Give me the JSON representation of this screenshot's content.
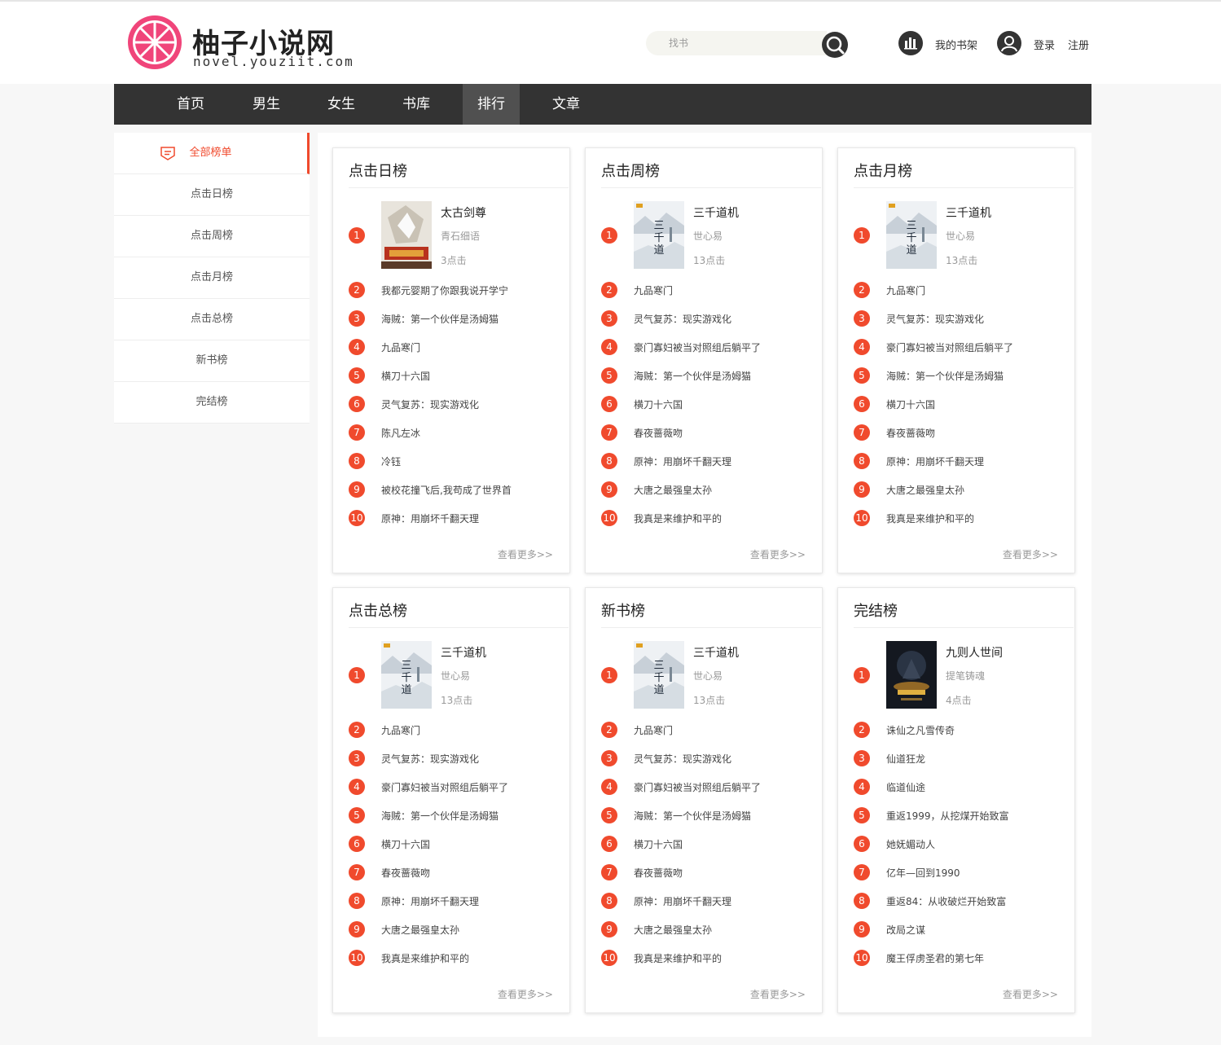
{
  "site": {
    "title": "柚子小说网",
    "subtitle": "novel.youziit.com"
  },
  "search": {
    "placeholder": "找书"
  },
  "header": {
    "shelf": "我的书架",
    "login": "登录",
    "register": "注册"
  },
  "nav": [
    "首页",
    "男生",
    "女生",
    "书库",
    "排行",
    "文章"
  ],
  "sidebar": [
    "全部榜单",
    "点击日榜",
    "点击周榜",
    "点击月榜",
    "点击总榜",
    "新书榜",
    "完结榜"
  ],
  "more_label": "查看更多>>",
  "colors": {
    "accent": "#f04a2d",
    "nav": "#333333"
  },
  "cards": [
    {
      "title": "点击日榜",
      "cover": "dragon",
      "top": {
        "name": "太古剑尊",
        "author": "青石细语",
        "clicks": "3点击"
      },
      "items": [
        "我都元婴期了你跟我说开学宁",
        "海贼：第一个伙伴是汤姆猫",
        "九品寒门",
        "横刀十六国",
        "灵气复苏：现实游戏化",
        "陈凡左冰",
        "冷钰",
        "被校花撞飞后,我苟成了世界首",
        "原神：用崩坏千翻天理"
      ]
    },
    {
      "title": "点击周榜",
      "cover": "mountain",
      "top": {
        "name": "三千道机",
        "author": "世心易",
        "clicks": "13点击"
      },
      "items": [
        "九品寒门",
        "灵气复苏：现实游戏化",
        "豪门寡妇被当对照组后躺平了",
        "海贼：第一个伙伴是汤姆猫",
        "横刀十六国",
        "春夜蔷薇吻",
        "原神：用崩坏千翻天理",
        "大唐之最强皇太孙",
        "我真是来维护和平的"
      ]
    },
    {
      "title": "点击月榜",
      "cover": "mountain",
      "top": {
        "name": "三千道机",
        "author": "世心易",
        "clicks": "13点击"
      },
      "items": [
        "九品寒门",
        "灵气复苏：现实游戏化",
        "豪门寡妇被当对照组后躺平了",
        "海贼：第一个伙伴是汤姆猫",
        "横刀十六国",
        "春夜蔷薇吻",
        "原神：用崩坏千翻天理",
        "大唐之最强皇太孙",
        "我真是来维护和平的"
      ]
    },
    {
      "title": "点击总榜",
      "cover": "mountain",
      "top": {
        "name": "三千道机",
        "author": "世心易",
        "clicks": "13点击"
      },
      "items": [
        "九品寒门",
        "灵气复苏：现实游戏化",
        "豪门寡妇被当对照组后躺平了",
        "海贼：第一个伙伴是汤姆猫",
        "横刀十六国",
        "春夜蔷薇吻",
        "原神：用崩坏千翻天理",
        "大唐之最强皇太孙",
        "我真是来维护和平的"
      ]
    },
    {
      "title": "新书榜",
      "cover": "mountain",
      "top": {
        "name": "三千道机",
        "author": "世心易",
        "clicks": "13点击"
      },
      "items": [
        "九品寒门",
        "灵气复苏：现实游戏化",
        "豪门寡妇被当对照组后躺平了",
        "海贼：第一个伙伴是汤姆猫",
        "横刀十六国",
        "春夜蔷薇吻",
        "原神：用崩坏千翻天理",
        "大唐之最强皇太孙",
        "我真是来维护和平的"
      ]
    },
    {
      "title": "完结榜",
      "cover": "dark",
      "top": {
        "name": "九则人世间",
        "author": "提笔铸魂",
        "clicks": "4点击"
      },
      "items": [
        "诛仙之凡雪传奇",
        "仙道狂龙",
        "临道仙途",
        "重返1999，从挖煤开始致富",
        "她妩媚动人",
        "亿年—回到1990",
        "重返84：从收破烂开始致富",
        "改局之谋",
        "魔王俘虏圣君的第七年"
      ]
    }
  ]
}
